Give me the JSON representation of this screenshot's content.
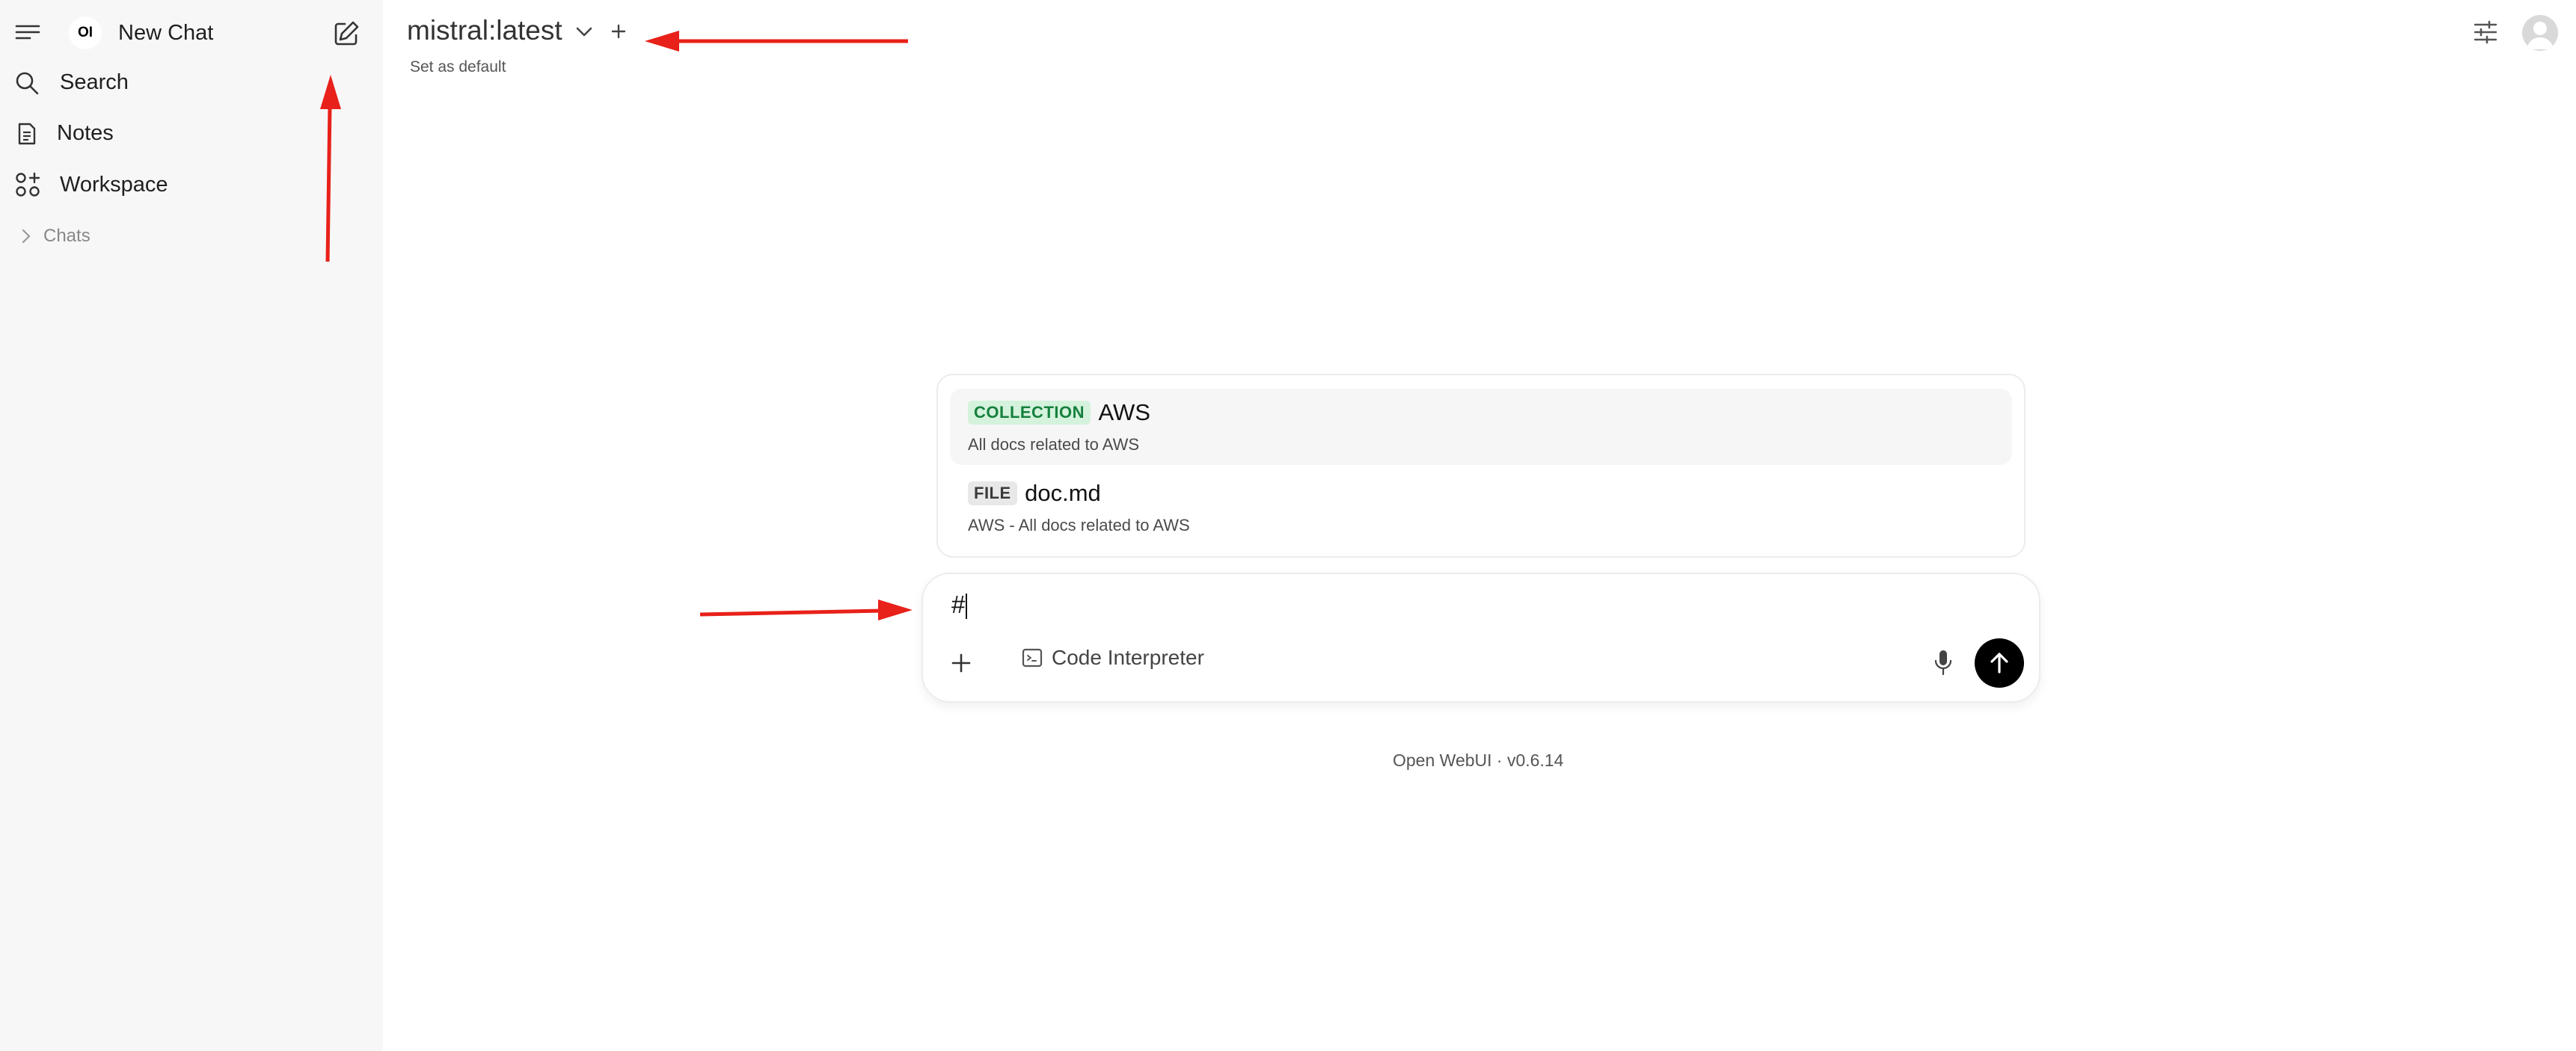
{
  "sidebar": {
    "logo_text": "OI",
    "new_chat_label": "New Chat",
    "nav_items": [
      {
        "label": "Search",
        "icon": "search-icon"
      },
      {
        "label": "Notes",
        "icon": "notes-icon"
      },
      {
        "label": "Workspace",
        "icon": "workspace-icon"
      }
    ],
    "chats_section_label": "Chats"
  },
  "header": {
    "model_name": "mistral:latest",
    "set_default_label": "Set as default"
  },
  "knowledge_popup": {
    "items": [
      {
        "type": "COLLECTION",
        "name": "AWS",
        "description": "All docs related to AWS"
      },
      {
        "type": "FILE",
        "name": "doc.md",
        "description": "AWS - All docs related to AWS"
      }
    ]
  },
  "composer": {
    "input_value": "#",
    "code_interpreter_label": "Code Interpreter"
  },
  "footer": {
    "version_text": "Open WebUI · v0.6.14"
  },
  "colors": {
    "sidebar_bg": "#f7f7f7",
    "collection_tag_bg": "#d4f2dc",
    "collection_tag_fg": "#15803d",
    "annotation_arrow": "#e8211a",
    "send_button_bg": "#000000"
  }
}
